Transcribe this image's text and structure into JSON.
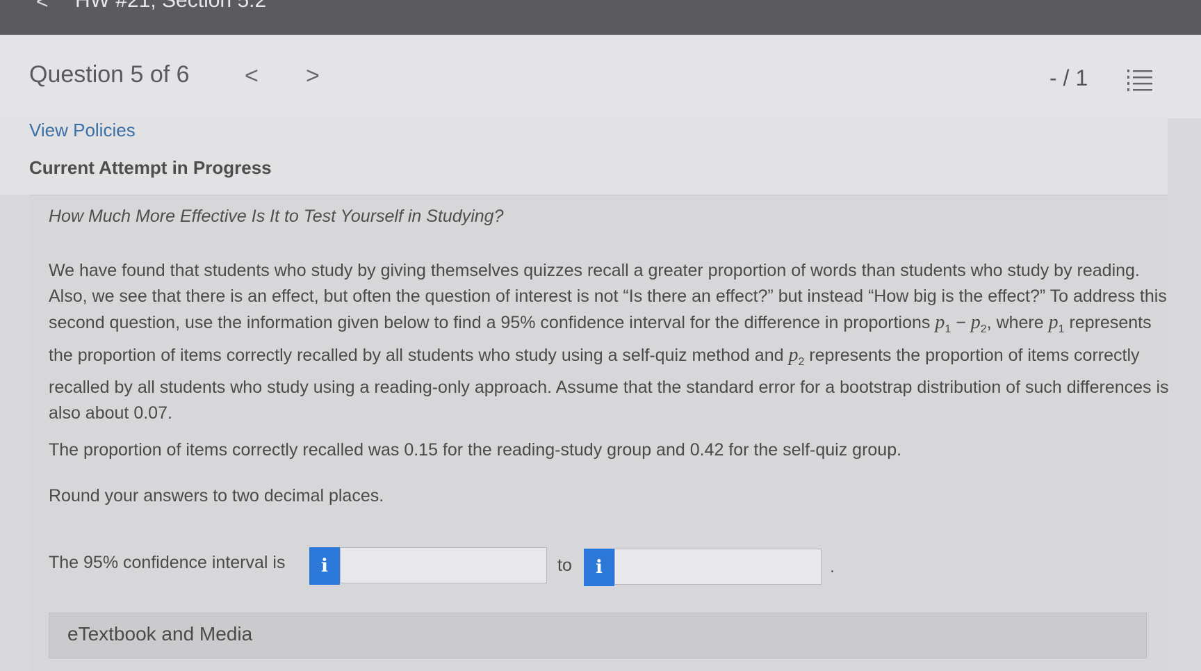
{
  "topbar": {
    "back_glyph": "<",
    "assignment_title": "HW #21, Section 5.2"
  },
  "header": {
    "question_title": "Question 5 of 6",
    "prev_glyph": "<",
    "next_glyph": ">",
    "score": "- / 1"
  },
  "links": {
    "view_policies": "View Policies",
    "attempt_status": "Current Attempt in Progress"
  },
  "question": {
    "heading": "How Much More Effective Is It to Test Yourself in Studying?",
    "para_a": "We have found that students who study by giving themselves quizzes recall a greater proportion of words than students who study by reading. Also, we see that there is an effect, but often the question of interest is not “Is there an effect?” but instead “How big is the effect?” To address this second question, use the information given below to find a ",
    "conf_level": "95%",
    "para_b": " confidence interval for the difference in proportions ",
    "var_p": "p",
    "sub_1": "1",
    "sub_2": "2",
    "minus": " − ",
    "para_c": ", where ",
    "para_d": " represents the proportion of items correctly recalled by all students who study using a self-quiz method and ",
    "para_e": " represents the proportion of items correctly recalled by all students who study using a reading-only approach. Assume that the standard error for a bootstrap distribution of such differences is also about 0.07.",
    "para2": "The proportion of items correctly recalled was 0.15 for the reading-study group and 0.42 for the self-quiz group.",
    "para3": "Round your answers to two decimal places."
  },
  "answer": {
    "ci_label": "The 95% confidence interval is",
    "info_glyph": "i",
    "lower_value": "",
    "to_label": "to",
    "upper_value": "",
    "period": "."
  },
  "etextbook": {
    "label": "eTextbook and Media"
  },
  "colors": {
    "info_button": "#2c78d8",
    "link": "#3a6fa6",
    "topbar": "#5b5b5f"
  }
}
